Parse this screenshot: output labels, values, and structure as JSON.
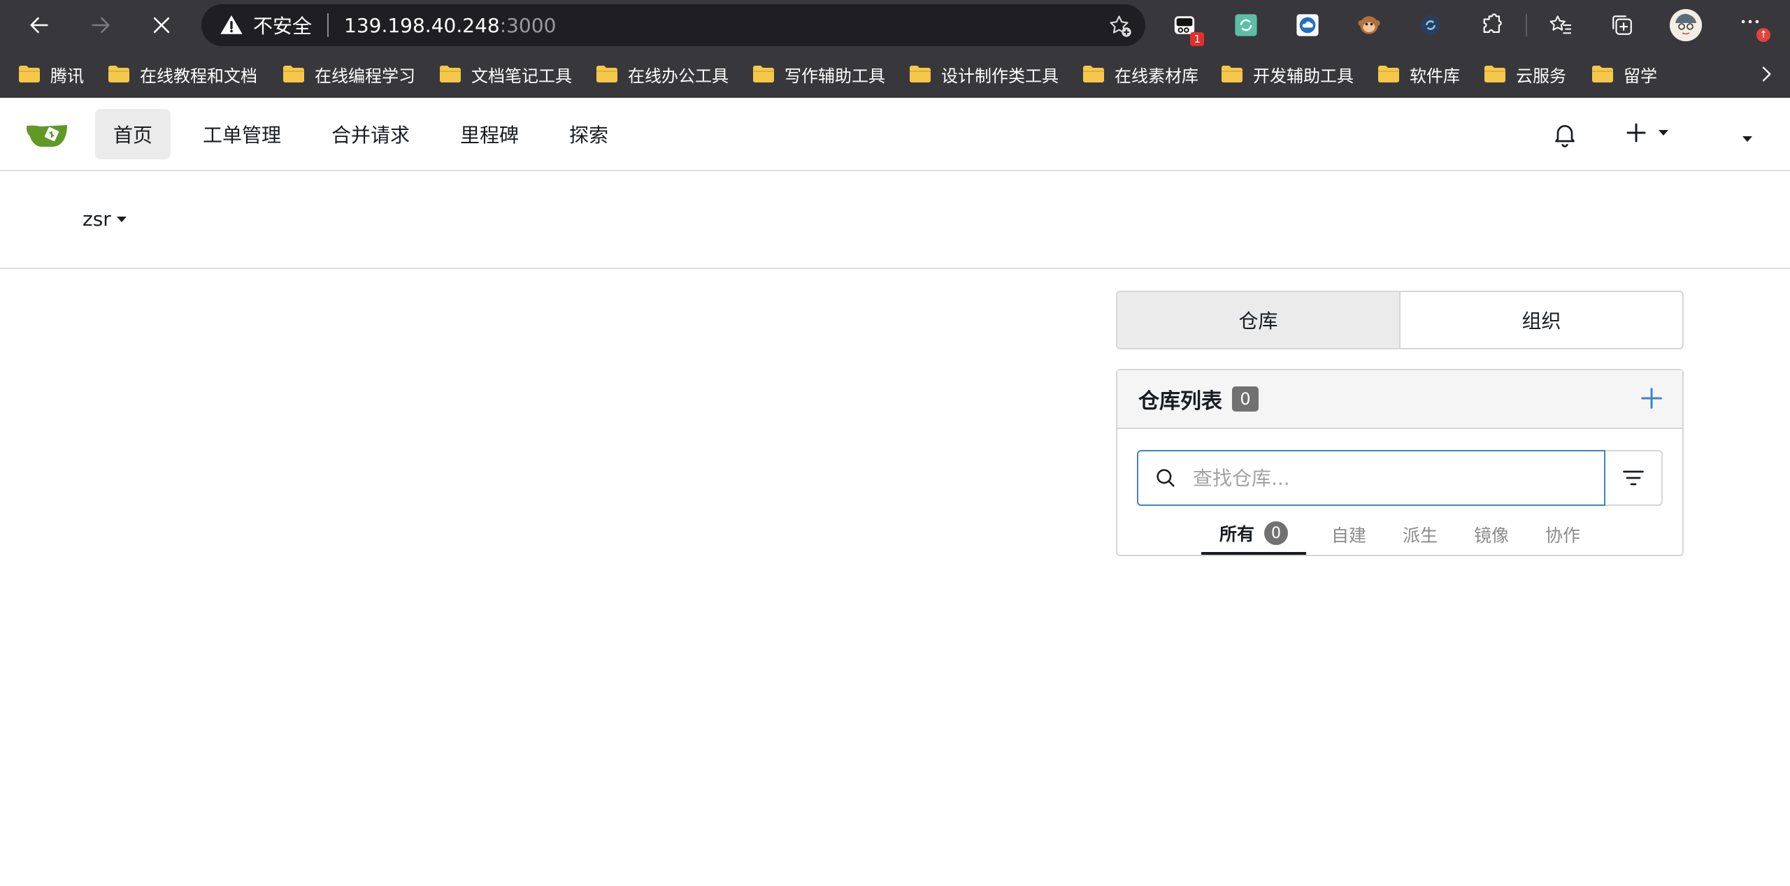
{
  "browser": {
    "security_label": "不安全",
    "url_host": "139.198.40.248",
    "url_port": ":3000",
    "extension_badge": "1",
    "menu_badge": "↑"
  },
  "bookmarks": [
    {
      "label": "腾讯"
    },
    {
      "label": "在线教程和文档"
    },
    {
      "label": "在线编程学习"
    },
    {
      "label": "文档笔记工具"
    },
    {
      "label": "在线办公工具"
    },
    {
      "label": "写作辅助工具"
    },
    {
      "label": "设计制作类工具"
    },
    {
      "label": "在线素材库"
    },
    {
      "label": "开发辅助工具"
    },
    {
      "label": "软件库"
    },
    {
      "label": "云服务"
    },
    {
      "label": "留学"
    }
  ],
  "nav": {
    "items": [
      {
        "label": "首页"
      },
      {
        "label": "工单管理"
      },
      {
        "label": "合并请求"
      },
      {
        "label": "里程碑"
      },
      {
        "label": "探索"
      }
    ]
  },
  "context": {
    "user": "zsr"
  },
  "dashboard": {
    "tabs": [
      {
        "label": "仓库"
      },
      {
        "label": "组织"
      }
    ],
    "repo_list": {
      "title": "仓库列表",
      "count": "0",
      "search_placeholder": "查找仓库...",
      "filters": [
        {
          "label": "所有",
          "count": "0"
        },
        {
          "label": "自建"
        },
        {
          "label": "派生"
        },
        {
          "label": "镜像"
        },
        {
          "label": "协作"
        }
      ]
    }
  },
  "colors": {
    "gitea_green": "#609926",
    "link_blue": "#4183c4",
    "chrome_bg": "#38383c"
  }
}
